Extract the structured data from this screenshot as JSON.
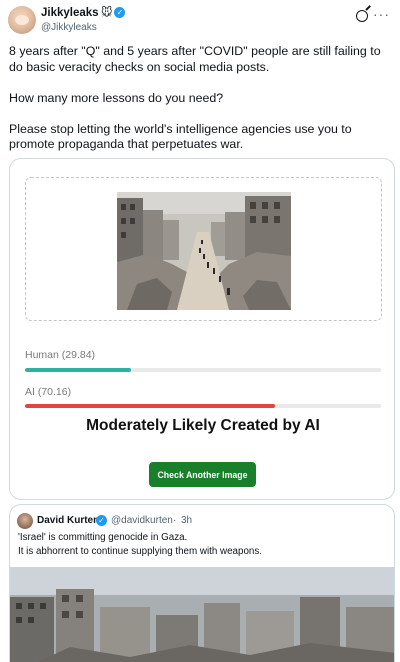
{
  "post": {
    "author_name": "Jikkyleaks",
    "author_emoji": "🐭",
    "author_handle": "@Jikkyleaks",
    "paragraphs": [
      "8 years after \"Q\" and 5 years after \"COVID\" people are still failing to do basic veracity checks on social media posts.",
      "How many more lessons do you need?",
      "Please stop letting the world's intelligence agencies use you to promote propaganda that perpetuates war."
    ],
    "more_icon": "more-horizontal-icon",
    "grok_icon": "grok-icon"
  },
  "detector": {
    "human_label": "Human (29.84)",
    "human_score": 29.84,
    "human_color": "#2bb3a0",
    "ai_label": "AI (70.16)",
    "ai_score": 70.16,
    "ai_color": "#e04545",
    "verdict": "Moderately Likely Created by AI",
    "button_label": "Check Another Image",
    "button_color": "#1a7f2a"
  },
  "quoted_post": {
    "author_name": "David Kurten",
    "author_handle": "@davidkurten",
    "separator": "·",
    "time": "3h",
    "lines": [
      "'Israel' is committing genocide in Gaza.",
      "It is abhorrent to continue supplying them with weapons."
    ]
  },
  "colors": {
    "verified_badge": "#1d9bf0",
    "border": "#cfd9de",
    "secondary_text": "#536471"
  }
}
